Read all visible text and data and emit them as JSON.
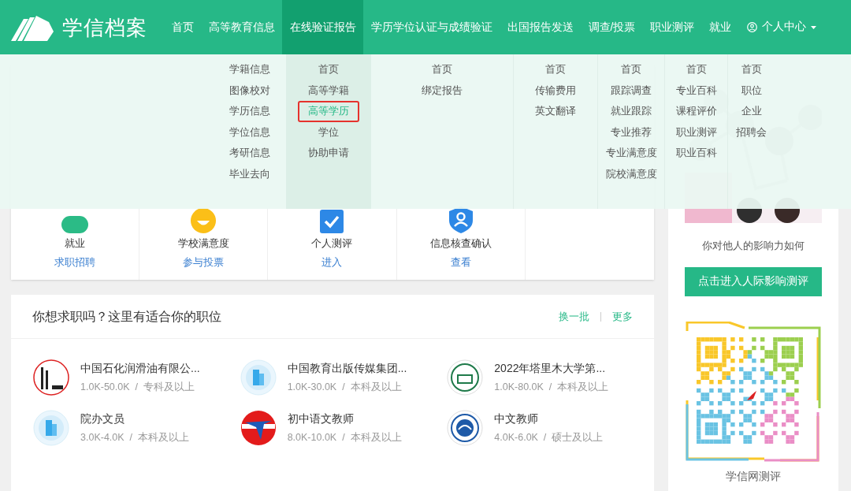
{
  "logo": {
    "text": "学信档案"
  },
  "nav": [
    {
      "label": "首页",
      "selected": false
    },
    {
      "label": "高等教育信息",
      "selected": false
    },
    {
      "label": "在线验证报告",
      "selected": true
    },
    {
      "label": "学历学位认证与成绩验证",
      "selected": false
    },
    {
      "label": "出国报告发送",
      "selected": false
    },
    {
      "label": "调查/投票",
      "selected": false
    },
    {
      "label": "职业测评",
      "selected": false
    },
    {
      "label": "就业",
      "selected": false
    }
  ],
  "user_menu": {
    "label": "个人中心"
  },
  "dropdown": {
    "columns": [
      {
        "items": [
          {
            "label": "学籍信息",
            "selected": false
          },
          {
            "label": "图像校对",
            "selected": false
          },
          {
            "label": "学历信息",
            "selected": false
          },
          {
            "label": "学位信息",
            "selected": false
          },
          {
            "label": "考研信息",
            "selected": false
          },
          {
            "label": "毕业去向",
            "selected": false
          }
        ]
      },
      {
        "items": [
          {
            "label": "首页",
            "selected": false
          },
          {
            "label": "高等学籍",
            "selected": false
          },
          {
            "label": "高等学历",
            "selected": true
          },
          {
            "label": "学位",
            "selected": false
          },
          {
            "label": "协助申请",
            "selected": false
          }
        ]
      },
      {
        "items": [
          {
            "label": "首页",
            "selected": false
          },
          {
            "label": "绑定报告",
            "selected": false
          }
        ]
      },
      {
        "items": [
          {
            "label": "首页",
            "selected": false
          },
          {
            "label": "传输费用",
            "selected": false
          },
          {
            "label": "英文翻译",
            "selected": false
          }
        ]
      },
      {
        "items": [
          {
            "label": "首页",
            "selected": false
          },
          {
            "label": "跟踪调查",
            "selected": false
          },
          {
            "label": "就业跟踪",
            "selected": false
          },
          {
            "label": "专业推荐",
            "selected": false
          },
          {
            "label": "专业满意度",
            "selected": false
          },
          {
            "label": "院校满意度",
            "selected": false
          }
        ]
      },
      {
        "items": [
          {
            "label": "首页",
            "selected": false
          },
          {
            "label": "专业百科",
            "selected": false
          },
          {
            "label": "课程评价",
            "selected": false
          },
          {
            "label": "职业测评",
            "selected": false
          },
          {
            "label": "职业百科",
            "selected": false
          }
        ]
      },
      {
        "items": [
          {
            "label": "首页",
            "selected": false
          },
          {
            "label": "职位",
            "selected": false
          },
          {
            "label": "企业",
            "selected": false
          },
          {
            "label": "招聘会",
            "selected": false
          }
        ]
      }
    ]
  },
  "services": [
    {
      "kind": "offer",
      "title": "就业",
      "link": "求职招聘"
    },
    {
      "kind": "smiley",
      "title": "学校满意度",
      "link": "参与投票"
    },
    {
      "kind": "check",
      "title": "个人测评",
      "link": "进入"
    },
    {
      "kind": "shield",
      "title": "信息核查确认",
      "link": "查看"
    }
  ],
  "jobs": {
    "title": "你想求职吗？这里有适合你的职位",
    "actions": [
      "换一批",
      "更多"
    ],
    "items": [
      {
        "kind": "stripes",
        "name": "中国石化润滑油有限公...",
        "details": "1.0K-50.0K  /  专科及以上"
      },
      {
        "kind": "building",
        "name": "中国教育出版传媒集团...",
        "details": "1.0K-30.0K  /  本科及以上"
      },
      {
        "kind": "seal-green",
        "name": "2022年塔里木大学第...",
        "details": "1.0K-80.0K  /  本科及以上"
      },
      {
        "kind": "building",
        "name": "院办文员",
        "details": "3.0K-4.0K  /  本科及以上"
      },
      {
        "kind": "swoosh",
        "name": "初中语文教师",
        "details": "8.0K-10.0K  /  本科及以上"
      },
      {
        "kind": "seal-blue",
        "name": "中文教师",
        "details": "4.0K-6.0K  /  硕士及以上"
      }
    ]
  },
  "sidebar": {
    "prompt": "你对他人的影响力如何",
    "button": "点击进入人际影响测评",
    "qr_caption": "学信网测评"
  }
}
